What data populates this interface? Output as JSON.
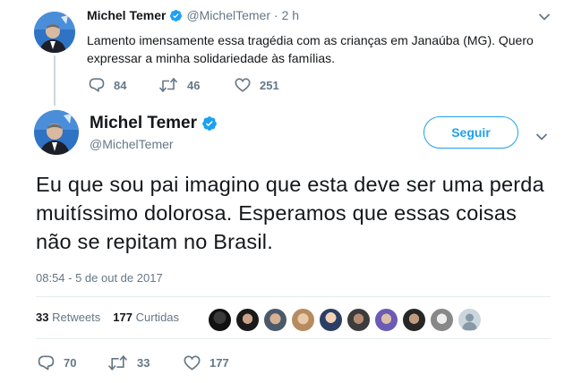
{
  "parent_tweet": {
    "name": "Michel Temer",
    "handle": "@MichelTemer",
    "time": "· 2 h",
    "text": "Lamento imensamente essa tragédia com as crianças em Janaúba (MG). Quero expressar a minha solidariedade às famílias.",
    "replies": "84",
    "retweets": "46",
    "likes": "251"
  },
  "main_tweet": {
    "name": "Michel Temer",
    "handle": "@MichelTemer",
    "follow_label": "Seguir",
    "text": "Eu que sou pai imagino que esta deve ser uma perda muitíssimo dolorosa. Esperamos que essas coisas não se repitam no Brasil.",
    "timestamp": "08:54 - 5 de out de 2017",
    "retweet_count": "33",
    "retweet_label": "Retweets",
    "like_count": "177",
    "like_label": "Curtidas",
    "replies": "70",
    "retweets": "33",
    "likes": "177"
  },
  "colors": {
    "accent": "#1da1f2",
    "text": "#14171a",
    "muted": "#657786",
    "divider": "#e6ecf0"
  },
  "icons": {
    "verified": "verified-badge-icon",
    "reply": "reply-icon",
    "retweet": "retweet-icon",
    "like": "heart-icon",
    "menu": "chevron-down-icon"
  }
}
